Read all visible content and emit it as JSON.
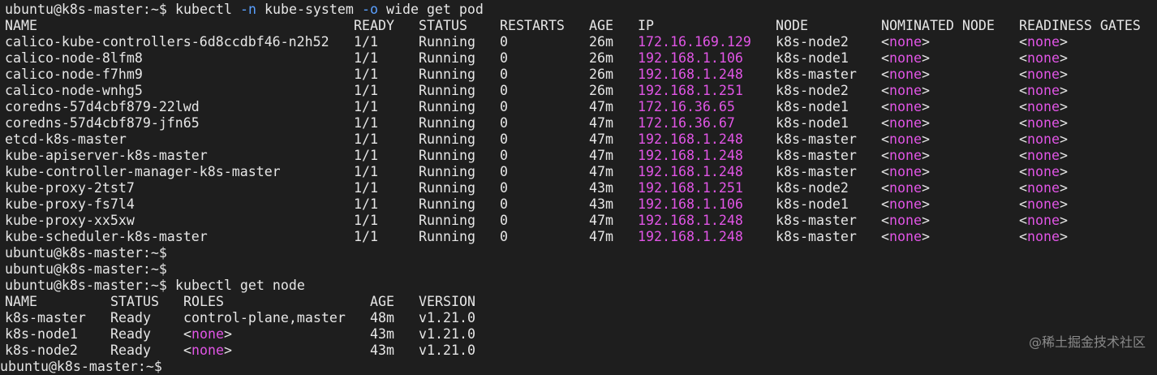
{
  "prompt": "ubuntu@k8s-master:~$",
  "cmd1": {
    "pre": "kubectl ",
    "flag1": "-n",
    "mid": " kube-system ",
    "flag2": "-o",
    "post": " wide get pod"
  },
  "pods": {
    "headers": [
      "NAME",
      "READY",
      "STATUS",
      "RESTARTS",
      "AGE",
      "IP",
      "NODE",
      "NOMINATED NODE",
      "READINESS GATES"
    ],
    "rows": [
      [
        "calico-kube-controllers-6d8ccdbf46-n2h52",
        "1/1",
        "Running",
        "0",
        "26m",
        "172.16.169.129",
        "k8s-node2",
        "none",
        "none"
      ],
      [
        "calico-node-8lfm8",
        "1/1",
        "Running",
        "0",
        "26m",
        "192.168.1.106",
        "k8s-node1",
        "none",
        "none"
      ],
      [
        "calico-node-f7hm9",
        "1/1",
        "Running",
        "0",
        "26m",
        "192.168.1.248",
        "k8s-master",
        "none",
        "none"
      ],
      [
        "calico-node-wnhg5",
        "1/1",
        "Running",
        "0",
        "26m",
        "192.168.1.251",
        "k8s-node2",
        "none",
        "none"
      ],
      [
        "coredns-57d4cbf879-22lwd",
        "1/1",
        "Running",
        "0",
        "47m",
        "172.16.36.65",
        "k8s-node1",
        "none",
        "none"
      ],
      [
        "coredns-57d4cbf879-jfn65",
        "1/1",
        "Running",
        "0",
        "47m",
        "172.16.36.67",
        "k8s-node1",
        "none",
        "none"
      ],
      [
        "etcd-k8s-master",
        "1/1",
        "Running",
        "0",
        "47m",
        "192.168.1.248",
        "k8s-master",
        "none",
        "none"
      ],
      [
        "kube-apiserver-k8s-master",
        "1/1",
        "Running",
        "0",
        "47m",
        "192.168.1.248",
        "k8s-master",
        "none",
        "none"
      ],
      [
        "kube-controller-manager-k8s-master",
        "1/1",
        "Running",
        "0",
        "47m",
        "192.168.1.248",
        "k8s-master",
        "none",
        "none"
      ],
      [
        "kube-proxy-2tst7",
        "1/1",
        "Running",
        "0",
        "43m",
        "192.168.1.251",
        "k8s-node2",
        "none",
        "none"
      ],
      [
        "kube-proxy-fs7l4",
        "1/1",
        "Running",
        "0",
        "43m",
        "192.168.1.106",
        "k8s-node1",
        "none",
        "none"
      ],
      [
        "kube-proxy-xx5xw",
        "1/1",
        "Running",
        "0",
        "47m",
        "192.168.1.248",
        "k8s-master",
        "none",
        "none"
      ],
      [
        "kube-scheduler-k8s-master",
        "1/1",
        "Running",
        "0",
        "47m",
        "192.168.1.248",
        "k8s-master",
        "none",
        "none"
      ]
    ]
  },
  "cmd2": "kubectl get node",
  "nodes": {
    "headers": [
      "NAME",
      "STATUS",
      "ROLES",
      "AGE",
      "VERSION"
    ],
    "rows": [
      [
        "k8s-master",
        "Ready",
        "control-plane,master",
        "48m",
        "v1.21.0"
      ],
      [
        "k8s-node1",
        "Ready",
        "<none>",
        "43m",
        "v1.21.0"
      ],
      [
        "k8s-node2",
        "Ready",
        "<none>",
        "43m",
        "v1.21.0"
      ]
    ]
  },
  "watermark": "@稀土掘金技术社区",
  "colors": {
    "background": "#1e1e1e",
    "text": "#e6e6e6",
    "flag": "#5aa0ff",
    "ip": "#e155e6"
  }
}
